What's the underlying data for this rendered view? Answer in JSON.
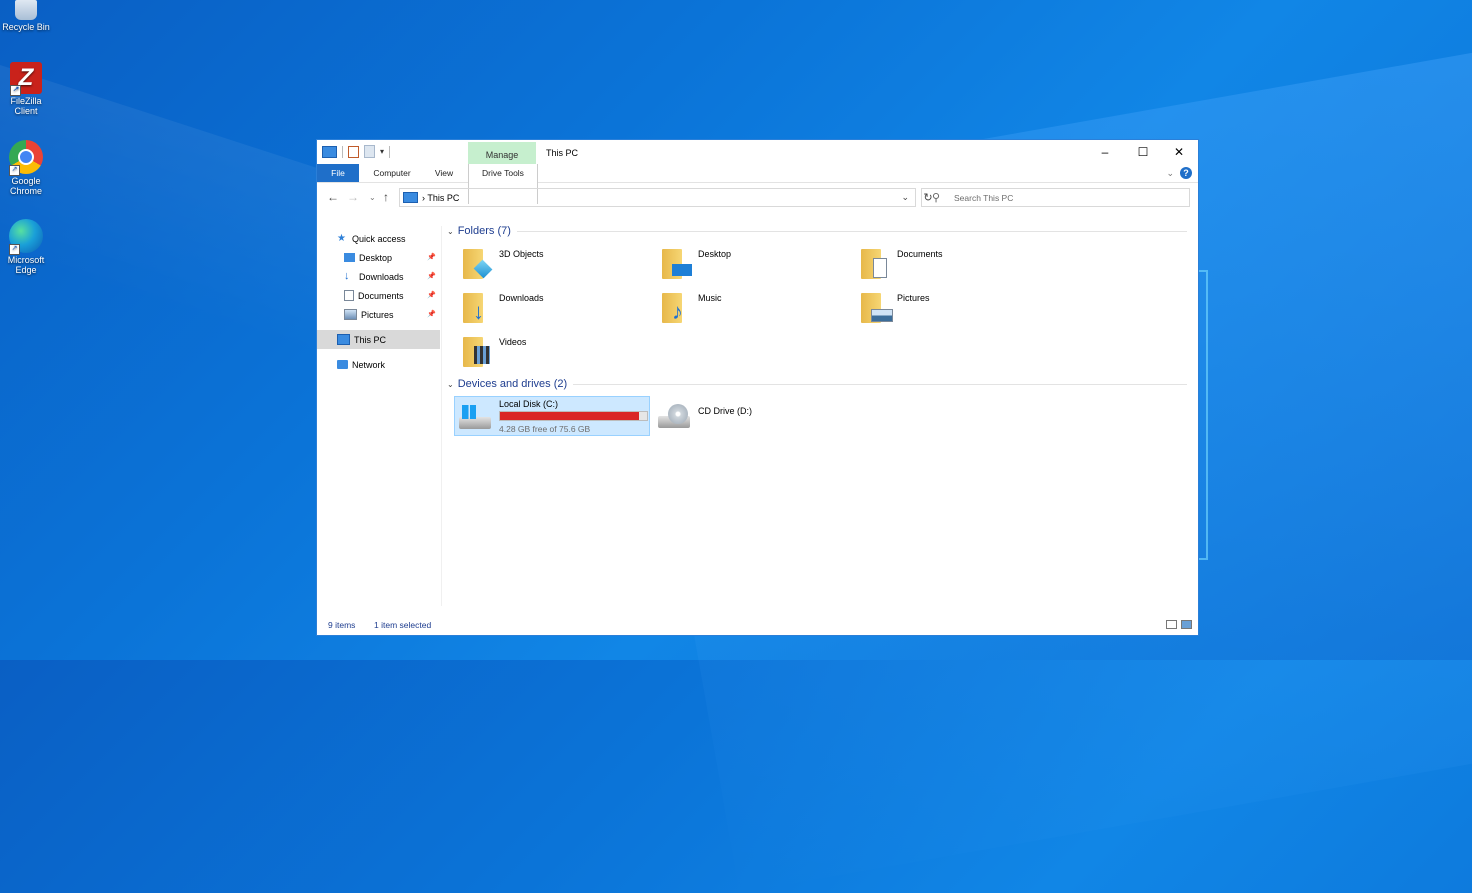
{
  "desktop": {
    "icons": [
      {
        "label": "Recycle Bin"
      },
      {
        "label": "FileZilla Client",
        "glyph": "Z"
      },
      {
        "label": "Google Chrome"
      },
      {
        "label": "Microsoft Edge"
      }
    ]
  },
  "window": {
    "title": "This PC",
    "manage_tab": "Manage",
    "tabs": [
      "File",
      "Computer",
      "View",
      "Drive Tools"
    ],
    "controls": {
      "minimize": "–",
      "maximize": "☐",
      "close": "✕"
    },
    "help": "?",
    "address": {
      "crumb": "This PC",
      "separator": "›"
    },
    "search_placeholder": "Search This PC"
  },
  "nav_pane": {
    "items": [
      {
        "label": "Quick access"
      },
      {
        "label": "Desktop",
        "pinned": true
      },
      {
        "label": "Downloads",
        "pinned": true
      },
      {
        "label": "Documents",
        "pinned": true
      },
      {
        "label": "Pictures",
        "pinned": true
      },
      {
        "label": "This PC",
        "selected": true
      },
      {
        "label": "Network"
      }
    ]
  },
  "content": {
    "folders_header": "Folders (7)",
    "folders": [
      {
        "label": "3D Objects"
      },
      {
        "label": "Desktop"
      },
      {
        "label": "Documents"
      },
      {
        "label": "Downloads"
      },
      {
        "label": "Music"
      },
      {
        "label": "Pictures"
      },
      {
        "label": "Videos"
      }
    ],
    "drives_header": "Devices and drives (2)",
    "drives": [
      {
        "label": "Local Disk (C:)",
        "free_text": "4.28 GB free of 75.6 GB",
        "used_fraction": 0.943,
        "selected": true
      },
      {
        "label": "CD Drive (D:)"
      }
    ]
  },
  "status": {
    "items": "9 items",
    "selected": "1 item selected"
  },
  "colors": {
    "accent": "#1f6fc9",
    "manage_tab": "#c6efce",
    "drive_bar_full": "#da2626",
    "selection": "#cde8ff"
  }
}
